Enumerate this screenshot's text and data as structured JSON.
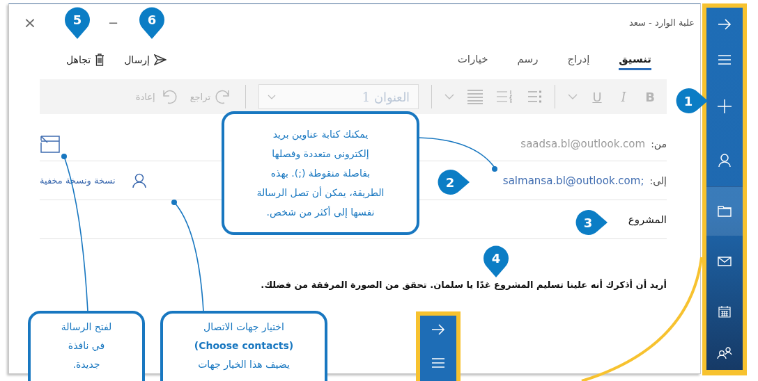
{
  "window": {
    "title": "علبة الوارد - سعد",
    "close": "×",
    "minimize": "−"
  },
  "commands": [
    {
      "kind": "send",
      "label": "إرسال"
    },
    {
      "kind": "discard",
      "label": "تجاهل"
    }
  ],
  "tabs": [
    {
      "label": "تنسيق",
      "selected": true
    },
    {
      "label": "إدراج",
      "selected": false
    },
    {
      "label": "رسم",
      "selected": false
    },
    {
      "label": "خيارات",
      "selected": false
    }
  ],
  "toolbar": {
    "disabled": true,
    "bold": "B",
    "italic": "I",
    "underline": "U",
    "style": "العنوان 1",
    "redo": "تراجع",
    "undo": "إعادة"
  },
  "fields": {
    "from_label": "من:",
    "from": "saadsa.bl@outlook.com",
    "to_label": "إلى:",
    "to": "salmansa.bl@outlook.com;",
    "cc_bcc": "نسخة ونسخة مخفية",
    "subject": "المشروع"
  },
  "body": "أريد أن أذكرك أنه علينا تسليم المشروع غدًا يا سلمان. تحقق من الصورة المرفقة من فضلك.",
  "sidebar": {
    "items": [
      {
        "kind": "arrow",
        "selected": false
      },
      {
        "kind": "menu",
        "selected": false
      },
      {
        "kind": "new",
        "selected": false
      },
      {
        "kind": "person",
        "selected": false
      },
      {
        "kind": "folder",
        "selected": true
      },
      {
        "kind": "mail",
        "selected": false
      },
      {
        "kind": "calendar",
        "selected": false
      },
      {
        "kind": "people",
        "selected": false
      }
    ]
  },
  "mini_sidebar": {
    "items": [
      {
        "kind": "arrow"
      },
      {
        "kind": "menu"
      }
    ]
  },
  "markers": [
    {
      "label": "1",
      "kind": "side"
    },
    {
      "label": "2",
      "kind": "side"
    },
    {
      "label": "3",
      "kind": "side"
    },
    {
      "label": "4",
      "kind": "down"
    },
    {
      "label": "5",
      "kind": "down"
    },
    {
      "label": "6",
      "kind": "down"
    }
  ],
  "callouts": [
    {
      "lines": [
        "يمكنك كتابة عناوين بريد",
        "إلكتروني متعددة وفصلها",
        "بفاصلة منقوطة (;). بهذه",
        "الطريقة، يمكن أن تصل الرسالة",
        "نفسها إلى أكثر من شخص."
      ]
    },
    {
      "lines": [
        "اختيار جهات الاتصال",
        "**(Choose contacts)**",
        "يضيف هذا الخيار جهات"
      ]
    },
    {
      "lines": [
        "لفتح الرسالة",
        "في نافذة",
        "جديدة."
      ]
    }
  ]
}
